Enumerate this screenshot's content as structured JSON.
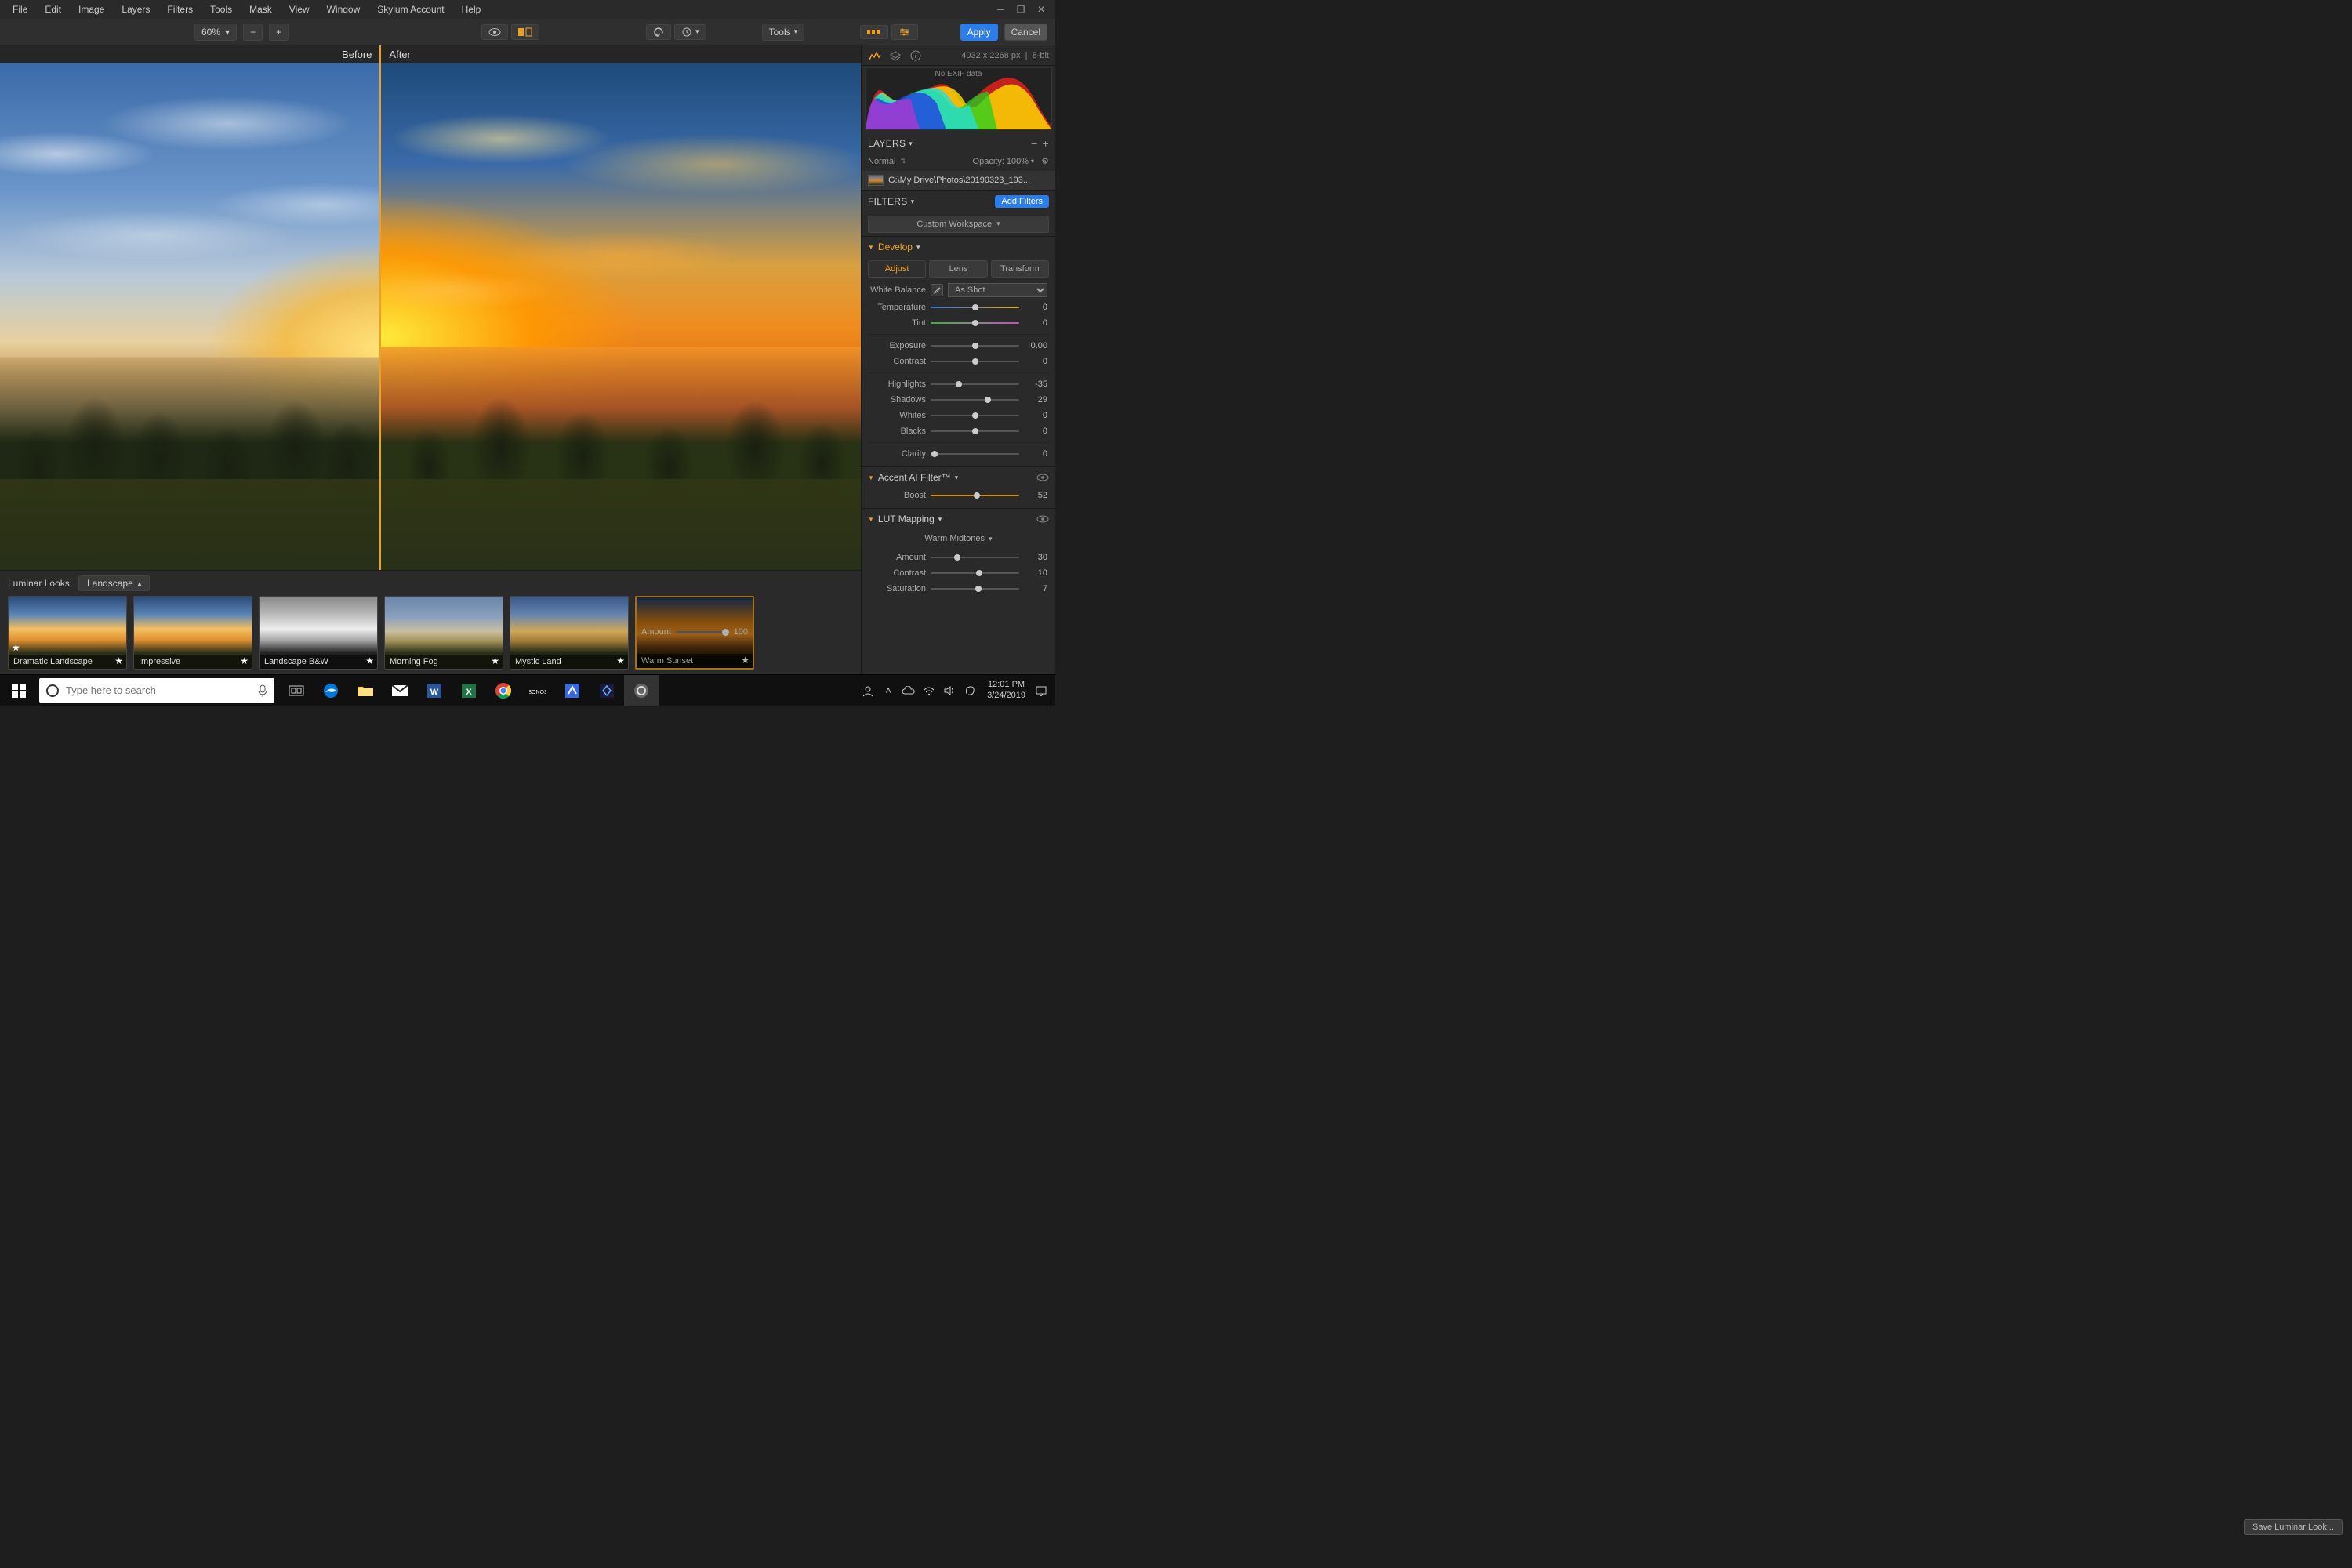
{
  "menubar": {
    "items": [
      "File",
      "Edit",
      "Image",
      "Layers",
      "Filters",
      "Tools",
      "Mask",
      "View",
      "Window",
      "Skylum Account",
      "Help"
    ]
  },
  "toolbar": {
    "zoom": "60%",
    "tools_label": "Tools",
    "apply_label": "Apply",
    "cancel_label": "Cancel"
  },
  "compare": {
    "before_label": "Before",
    "after_label": "After"
  },
  "image_info": {
    "dimensions": "4032 x 2268 px",
    "depth": "8-bit"
  },
  "histogram": {
    "no_exif": "No EXIF data"
  },
  "layers": {
    "title": "LAYERS",
    "blend_mode": "Normal",
    "opacity_label": "Opacity:",
    "opacity_value": "100%",
    "layer_path": "G:\\My Drive\\Photos\\20190323_193..."
  },
  "filters": {
    "title": "FILTERS",
    "add_label": "Add Filters",
    "workspace": "Custom Workspace",
    "develop": {
      "title": "Develop",
      "tabs": [
        "Adjust",
        "Lens",
        "Transform"
      ],
      "white_balance_label": "White Balance",
      "wb_preset": "As Shot",
      "rows": {
        "temperature": {
          "label": "Temperature",
          "value": "0",
          "pos": 50
        },
        "tint": {
          "label": "Tint",
          "value": "0",
          "pos": 50
        },
        "exposure": {
          "label": "Exposure",
          "value": "0.00",
          "pos": 50
        },
        "contrast": {
          "label": "Contrast",
          "value": "0",
          "pos": 50
        },
        "highlights": {
          "label": "Highlights",
          "value": "-35",
          "pos": 32
        },
        "shadows": {
          "label": "Shadows",
          "value": "29",
          "pos": 65
        },
        "whites": {
          "label": "Whites",
          "value": "0",
          "pos": 50
        },
        "blacks": {
          "label": "Blacks",
          "value": "0",
          "pos": 50
        },
        "clarity": {
          "label": "Clarity",
          "value": "0",
          "pos": 4
        }
      }
    },
    "accent": {
      "title": "Accent AI Filter™",
      "boost": {
        "label": "Boost",
        "value": "52",
        "pos": 52
      }
    },
    "lut": {
      "title": "LUT Mapping",
      "preset": "Warm Midtones",
      "amount": {
        "label": "Amount",
        "value": "30",
        "pos": 30
      },
      "contrast": {
        "label": "Contrast",
        "value": "10",
        "pos": 55
      },
      "saturation": {
        "label": "Saturation",
        "value": "7",
        "pos": 54
      }
    }
  },
  "looks": {
    "header": "Luminar Looks:",
    "category": "Landscape",
    "items": [
      {
        "name": "Dramatic Landscape"
      },
      {
        "name": "Impressive"
      },
      {
        "name": "Landscape B&W"
      },
      {
        "name": "Morning Fog"
      },
      {
        "name": "Mystic Land"
      },
      {
        "name": "Warm Sunset"
      }
    ],
    "selected_amount_label": "Amount",
    "selected_amount_value": "100"
  },
  "save_look_label": "Save Luminar Look...",
  "taskbar": {
    "search_placeholder": "Type here to search",
    "time": "12:01 PM",
    "date": "3/24/2019"
  }
}
